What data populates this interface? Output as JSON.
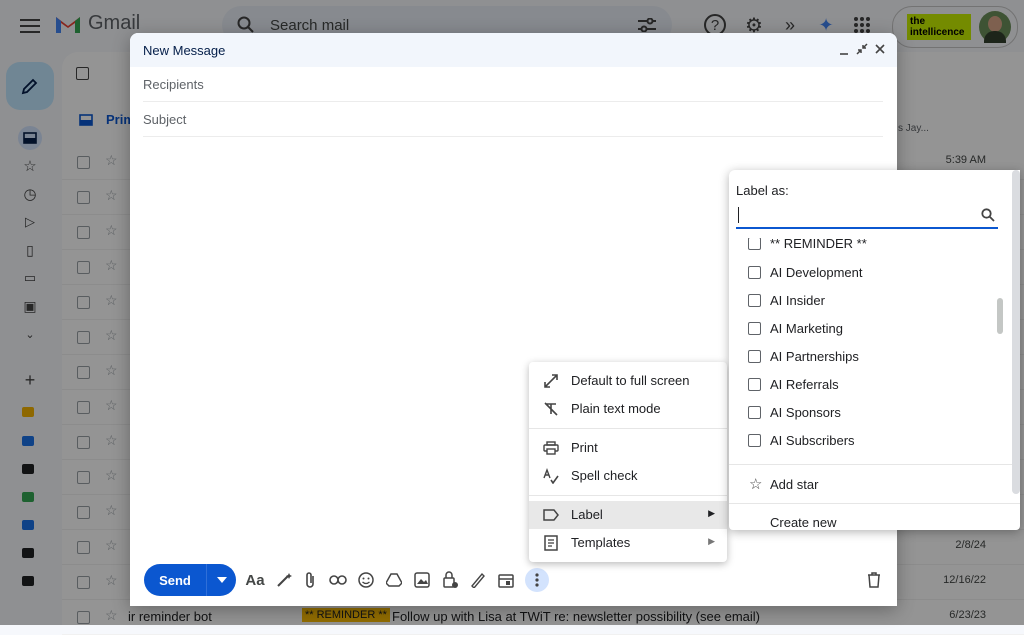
{
  "app": {
    "name": "Gmail",
    "search_placeholder": "Search mail",
    "account_badge": "the intellicence"
  },
  "inbox": {
    "tab_primary": "Prim",
    "snippet_hint": "s Jay...",
    "times": [
      "5:39 AM",
      "2/8/24",
      "12/16/22",
      "6/23/23"
    ],
    "last_row": {
      "sender": "ir reminder bot",
      "tag": "** REMINDER **",
      "subject": "Follow up with Lisa at TWiT re: newsletter possibility (see email)"
    }
  },
  "compose": {
    "title": "New Message",
    "recipients_placeholder": "Recipients",
    "subject_placeholder": "Subject",
    "send_label": "Send",
    "format_label": "Aa"
  },
  "more_menu": {
    "items": [
      {
        "label": "Default to full screen",
        "icon": "expand-icon"
      },
      {
        "label": "Plain text mode",
        "icon": "plain-text-icon"
      },
      {
        "label": "Print",
        "icon": "print-icon"
      },
      {
        "label": "Spell check",
        "icon": "spellcheck-icon"
      },
      {
        "label": "Label",
        "icon": "label-icon",
        "submenu": true,
        "selected": true
      },
      {
        "label": "Templates",
        "icon": "templates-icon",
        "submenu": true
      }
    ]
  },
  "label_panel": {
    "title": "Label as:",
    "search_value": "",
    "labels": [
      "** REMINDER **",
      "AI Development",
      "AI Insider",
      "AI Marketing",
      "AI Partnerships",
      "AI Referrals",
      "AI Sponsors",
      "AI Subscribers"
    ],
    "add_star": "Add star",
    "create_new": "Create new"
  },
  "colors": {
    "accent": "#0b57d0",
    "compose_header": "#f2f6fc",
    "overlay": "rgba(0,0,0,0.42)"
  }
}
